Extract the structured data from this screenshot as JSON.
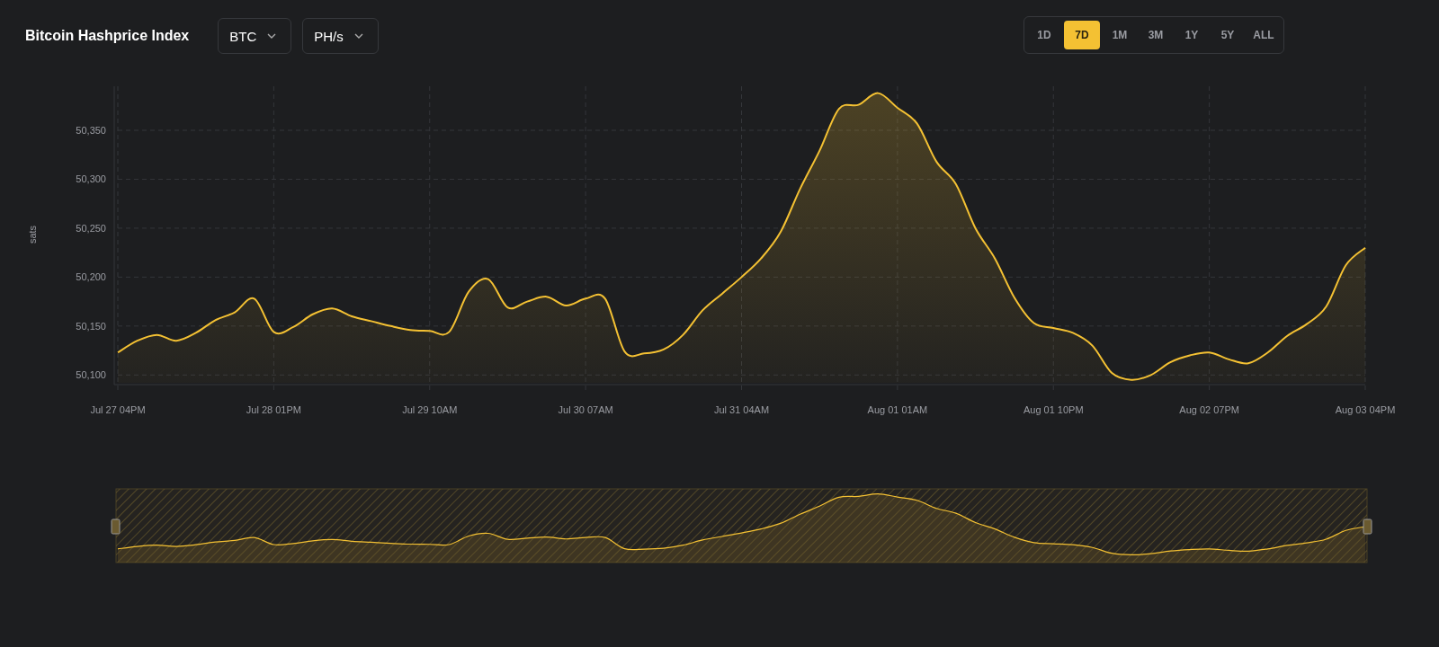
{
  "title": "Bitcoin Hashprice Index",
  "selectors": [
    {
      "label": "BTC"
    },
    {
      "label": "PH/s"
    }
  ],
  "ranges": [
    {
      "label": "1D",
      "selected": false
    },
    {
      "label": "7D",
      "selected": true
    },
    {
      "label": "1M",
      "selected": false
    },
    {
      "label": "3M",
      "selected": false
    },
    {
      "label": "1Y",
      "selected": false
    },
    {
      "label": "5Y",
      "selected": false
    },
    {
      "label": "ALL",
      "selected": false
    }
  ],
  "chart": {
    "chart_data": {
      "type": "area",
      "ylabel": "sats",
      "categories": [
        "Jul 27 04PM",
        null,
        null,
        null,
        null,
        null,
        null,
        null,
        "Jul 28 01PM",
        null,
        null,
        null,
        null,
        null,
        null,
        null,
        "Jul 29 10AM",
        null,
        null,
        null,
        null,
        null,
        null,
        null,
        "Jul 30 07AM",
        null,
        null,
        null,
        null,
        null,
        null,
        null,
        "Jul 31 04AM",
        null,
        null,
        null,
        null,
        null,
        null,
        null,
        "Aug 01 01AM",
        null,
        null,
        null,
        null,
        null,
        null,
        null,
        "Aug 01 10PM",
        null,
        null,
        null,
        null,
        null,
        null,
        null,
        "Aug 02 07PM",
        null,
        null,
        null,
        null,
        null,
        null,
        null,
        "Aug 03 04PM"
      ],
      "series": [
        {
          "color": "#f4c133",
          "values": [
            50123,
            50135,
            50141,
            50135,
            50143,
            50156,
            50164,
            50178,
            50144,
            50149,
            50162,
            50168,
            50160,
            50155,
            50150,
            50146,
            50145,
            50144,
            50185,
            50198,
            50169,
            50175,
            50180,
            50171,
            50178,
            50178,
            50124,
            50122,
            50126,
            50141,
            50166,
            50183,
            50200,
            50219,
            50246,
            50290,
            50329,
            50372,
            50376,
            50388,
            50373,
            50357,
            50318,
            50295,
            50250,
            50219,
            50179,
            50153,
            50148,
            50143,
            50130,
            50102,
            50095,
            50100,
            50113,
            50120,
            50123,
            50116,
            50112,
            50123,
            50140,
            50152,
            50170,
            50212,
            50230
          ]
        }
      ],
      "ylim": [
        50092,
        50395
      ],
      "grid": true,
      "yticks": [
        {
          "value": 50100,
          "label": "50,100"
        },
        {
          "value": 50150,
          "label": "50,150"
        },
        {
          "value": 50200,
          "label": "50,200"
        },
        {
          "value": 50250,
          "label": "50,250"
        },
        {
          "value": 50300,
          "label": "50,300"
        },
        {
          "value": 50350,
          "label": "50,350"
        }
      ]
    }
  }
}
